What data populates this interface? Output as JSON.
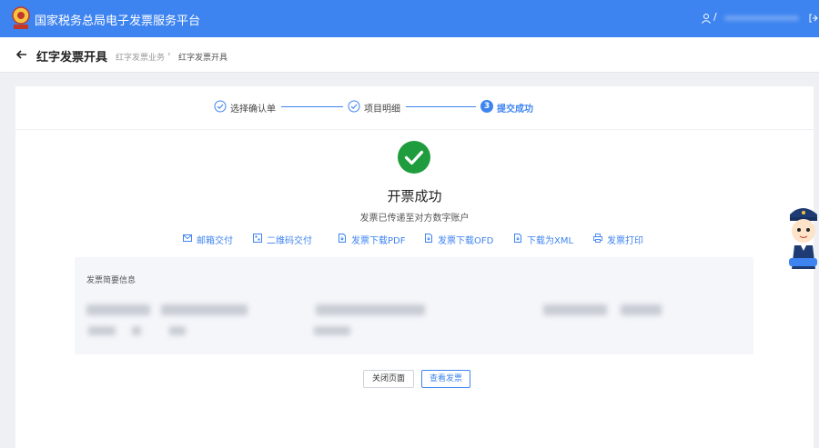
{
  "app": {
    "title": "国家税务总局电子发票服务平台",
    "user_separator": "/"
  },
  "header": {
    "page_title": "红字发票开具",
    "breadcrumb": [
      "红字发票业务",
      "红字发票开具"
    ],
    "breadcrumb_separator": "›"
  },
  "steps": [
    {
      "label": "选择确认单",
      "state": "done"
    },
    {
      "label": "项目明细",
      "state": "done"
    },
    {
      "label": "提交成功",
      "state": "active",
      "number": "3"
    }
  ],
  "result": {
    "title": "开票成功",
    "subtitle": "发票已传递至对方数字账户"
  },
  "actions": [
    {
      "label": "邮箱交付",
      "icon": "mail-icon"
    },
    {
      "label": "二维码交付",
      "icon": "qrcode-icon"
    },
    {
      "label": "发票下载PDF",
      "icon": "file-download-icon"
    },
    {
      "label": "发票下载OFD",
      "icon": "file-download-icon"
    },
    {
      "label": "下载为XML",
      "icon": "file-download-icon"
    },
    {
      "label": "发票打印",
      "icon": "printer-icon"
    }
  ],
  "summary": {
    "title": "发票简要信息"
  },
  "buttons": {
    "close": "关闭页面",
    "view": "查看发票"
  },
  "colors": {
    "primary": "#3e84f0",
    "success": "#1f9c3d",
    "page_bg": "#eef0f3",
    "summary_bg": "#f4f6fa"
  }
}
